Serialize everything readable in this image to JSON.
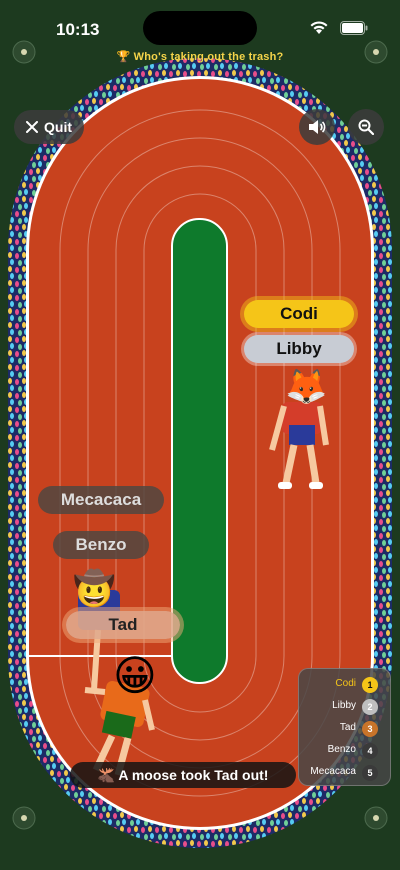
{
  "status": {
    "time": "10:13"
  },
  "game": {
    "title": "🏆 Who's taking out the trash?"
  },
  "controls": {
    "quit_label": "Quit"
  },
  "runners": [
    {
      "name": "Codi",
      "highlight": true
    },
    {
      "name": "Libby"
    },
    {
      "name": "Mecacaca"
    },
    {
      "name": "Benzo"
    },
    {
      "name": "Tad",
      "highlight": true
    }
  ],
  "toast": "🫎 A moose took Tad out!",
  "leaderboard": [
    {
      "name": "Codi",
      "rank": "1"
    },
    {
      "name": "Libby",
      "rank": "2"
    },
    {
      "name": "Tad",
      "rank": "3"
    },
    {
      "name": "Benzo",
      "rank": "4"
    },
    {
      "name": "Mecacaca",
      "rank": "5"
    }
  ],
  "colors": {
    "background": "#1d3a1f",
    "stands": "#1f2f6e",
    "track": "#c8421e",
    "infield": "#0e7a2c",
    "title": "#f5d44a",
    "gold": "#f5c518",
    "silver": "#bfbfbf",
    "bronze": "#c8742a"
  }
}
